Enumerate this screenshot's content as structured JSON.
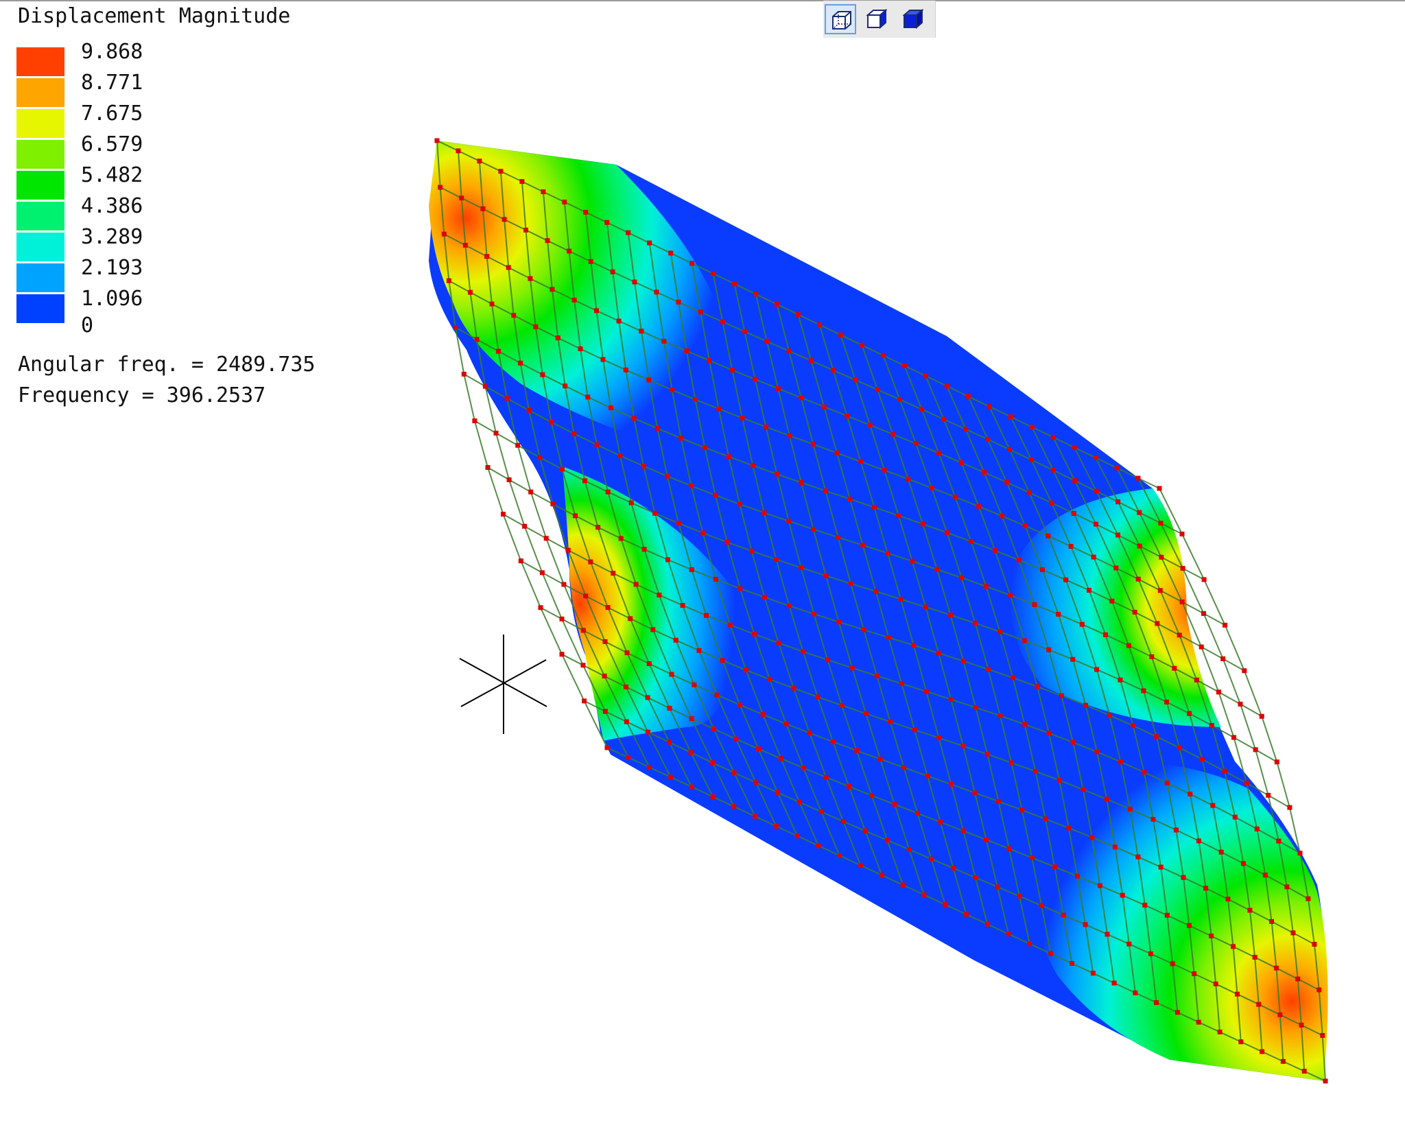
{
  "legend": {
    "title": "Displacement Magnitude",
    "values": [
      "9.868",
      "8.771",
      "7.675",
      "6.579",
      "5.482",
      "4.386",
      "3.289",
      "2.193",
      "1.096"
    ],
    "zero_label": "0",
    "colors": [
      "#ff4000",
      "#ffa500",
      "#e6f500",
      "#7ff000",
      "#00e600",
      "#00f070",
      "#00f0d8",
      "#00a4ff",
      "#0040ff"
    ]
  },
  "info": {
    "angular_freq": "Angular freq. = 2489.735",
    "frequency": "Frequency = 396.2537"
  },
  "toolbar": {
    "buttons": [
      {
        "name": "wireframe-view-icon",
        "active": true
      },
      {
        "name": "shaded-view-icon",
        "active": false
      },
      {
        "name": "solid-view-icon",
        "active": false
      }
    ]
  },
  "model": {
    "mesh_line_color": "#3a7a2a",
    "node_color": "#e00000",
    "axis_color": "#000000"
  }
}
